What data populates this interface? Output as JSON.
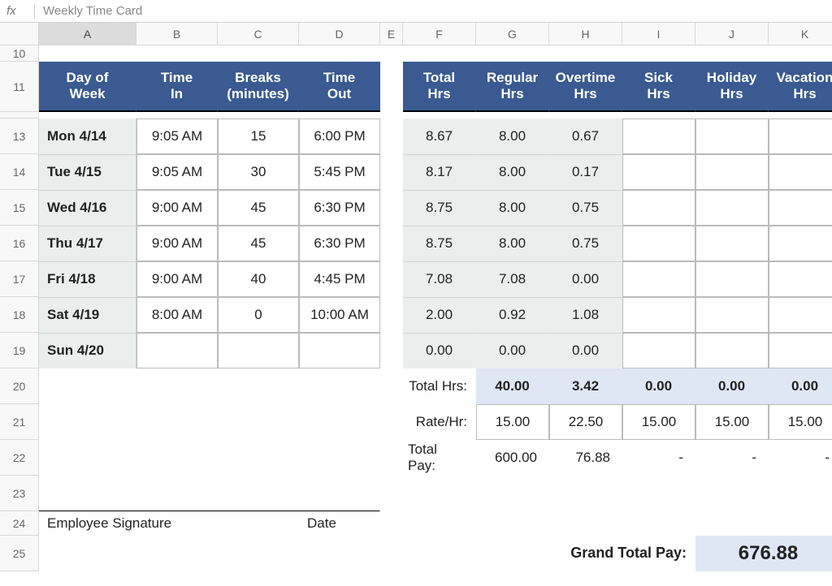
{
  "fx_label": "fx",
  "fx_content": "Weekly Time Card",
  "cols": [
    "A",
    "B",
    "C",
    "D",
    "E",
    "F",
    "G",
    "H",
    "I",
    "J",
    "K"
  ],
  "rows": [
    "10",
    "11",
    "13",
    "14",
    "15",
    "16",
    "17",
    "18",
    "19",
    "20",
    "21",
    "22",
    "23",
    "24",
    "25"
  ],
  "hdr_left": {
    "day": "Day of Week",
    "timein": "Time In",
    "breaks": "Breaks (minutes)",
    "timeout": "Time Out"
  },
  "hdr_right": {
    "total": "Total Hrs",
    "reg": "Regular Hrs",
    "ot": "Overtime Hrs",
    "sick": "Sick Hrs",
    "hol": "Holiday Hrs",
    "vac": "Vacation Hrs"
  },
  "days": [
    {
      "day": "Mon 4/14",
      "in": "9:05 AM",
      "br": "15",
      "out": "6:00 PM",
      "tot": "8.67",
      "reg": "8.00",
      "ot": "0.67",
      "sick": "",
      "hol": "",
      "vac": ""
    },
    {
      "day": "Tue 4/15",
      "in": "9:05 AM",
      "br": "30",
      "out": "5:45 PM",
      "tot": "8.17",
      "reg": "8.00",
      "ot": "0.17",
      "sick": "",
      "hol": "",
      "vac": ""
    },
    {
      "day": "Wed 4/16",
      "in": "9:00 AM",
      "br": "45",
      "out": "6:30 PM",
      "tot": "8.75",
      "reg": "8.00",
      "ot": "0.75",
      "sick": "",
      "hol": "",
      "vac": ""
    },
    {
      "day": "Thu 4/17",
      "in": "9:00 AM",
      "br": "45",
      "out": "6:30 PM",
      "tot": "8.75",
      "reg": "8.00",
      "ot": "0.75",
      "sick": "",
      "hol": "",
      "vac": ""
    },
    {
      "day": "Fri 4/18",
      "in": "9:00 AM",
      "br": "40",
      "out": "4:45 PM",
      "tot": "7.08",
      "reg": "7.08",
      "ot": "0.00",
      "sick": "",
      "hol": "",
      "vac": ""
    },
    {
      "day": "Sat 4/19",
      "in": "8:00 AM",
      "br": "0",
      "out": "10:00 AM",
      "tot": "2.00",
      "reg": "0.92",
      "ot": "1.08",
      "sick": "",
      "hol": "",
      "vac": ""
    },
    {
      "day": "Sun 4/20",
      "in": "",
      "br": "",
      "out": "",
      "tot": "0.00",
      "reg": "0.00",
      "ot": "0.00",
      "sick": "",
      "hol": "",
      "vac": ""
    }
  ],
  "summary": {
    "totalhrs_label": "Total Hrs:",
    "rate_label": "Rate/Hr:",
    "totalpay_label": "Total Pay:",
    "totals": {
      "reg": "40.00",
      "ot": "3.42",
      "sick": "0.00",
      "hol": "0.00",
      "vac": "0.00"
    },
    "rates": {
      "reg": "15.00",
      "ot": "22.50",
      "sick": "15.00",
      "hol": "15.00",
      "vac": "15.00"
    },
    "pays": {
      "reg": "600.00",
      "ot": "76.88",
      "sick": "-",
      "hol": "-",
      "vac": "-"
    }
  },
  "sig": {
    "emp": "Employee Signature",
    "date": "Date"
  },
  "grand": {
    "label": "Grand Total Pay:",
    "value": "676.88"
  }
}
